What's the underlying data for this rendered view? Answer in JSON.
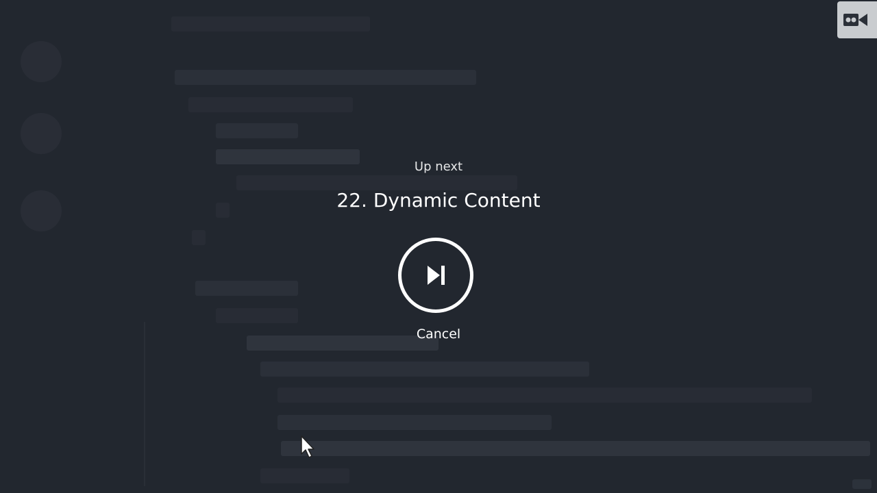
{
  "overlay": {
    "label": "Up next",
    "title": "22. Dynamic Content",
    "cancel_label": "Cancel"
  },
  "icons": {
    "play_next": "skip-next-icon",
    "logo": "video-camera-icon",
    "cursor": "mouse-pointer-icon"
  },
  "colors": {
    "background": "#22272f",
    "text": "#ffffff",
    "logo_bg": "#c9cccf"
  }
}
